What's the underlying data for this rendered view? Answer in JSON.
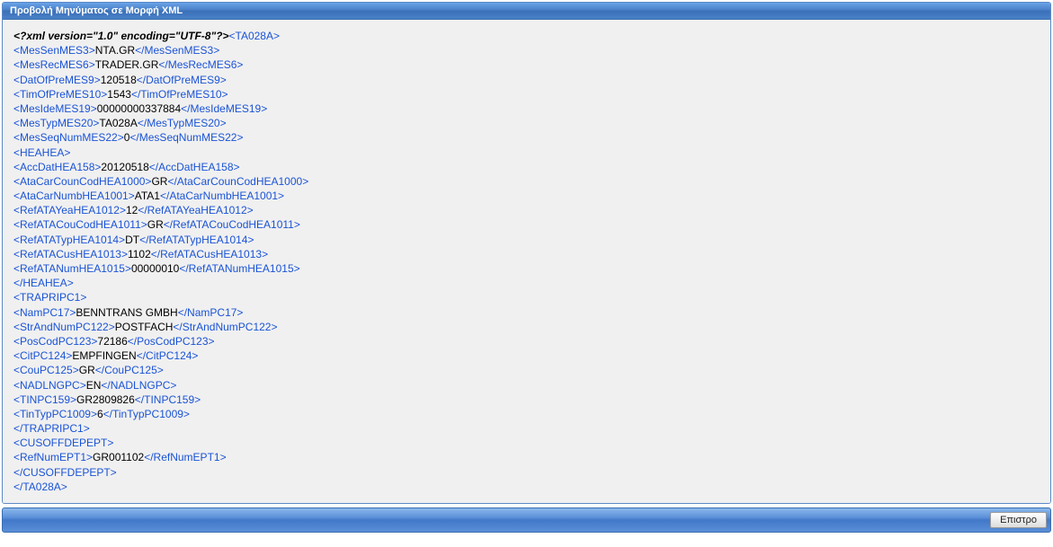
{
  "header": {
    "title": "Προβολή Μηνύματος σε Μορφή XML"
  },
  "footer": {
    "back_label": "Επιστρο"
  },
  "xml": {
    "declaration": "<?xml version=\"1.0\" encoding=\"UTF-8\"?>",
    "root": "TA028A",
    "lines": [
      {
        "type": "simple",
        "tag": "MesSenMES3",
        "value": "NTA.GR"
      },
      {
        "type": "simple",
        "tag": "MesRecMES6",
        "value": "TRADER.GR"
      },
      {
        "type": "simple",
        "tag": "DatOfPreMES9",
        "value": "120518"
      },
      {
        "type": "simple",
        "tag": "TimOfPreMES10",
        "value": "1543"
      },
      {
        "type": "simple",
        "tag": "MesIdeMES19",
        "value": "00000000337884"
      },
      {
        "type": "simple",
        "tag": "MesTypMES20",
        "value": "TA028A"
      },
      {
        "type": "simple",
        "tag": "MesSeqNumMES22",
        "value": "0"
      },
      {
        "type": "open",
        "tag": "HEAHEA"
      },
      {
        "type": "simple",
        "tag": "AccDatHEA158",
        "value": "20120518"
      },
      {
        "type": "simple",
        "tag": "AtaCarCounCodHEA1000",
        "value": "GR"
      },
      {
        "type": "simple",
        "tag": "AtaCarNumbHEA1001",
        "value": "ATA1"
      },
      {
        "type": "simple",
        "tag": "RefATAYeaHEA1012",
        "value": "12"
      },
      {
        "type": "simple",
        "tag": "RefATACouCodHEA1011",
        "value": "GR"
      },
      {
        "type": "simple",
        "tag": "RefATATypHEA1014",
        "value": "DT"
      },
      {
        "type": "simple",
        "tag": "RefATACusHEA1013",
        "value": "1102"
      },
      {
        "type": "simple",
        "tag": "RefATANumHEA1015",
        "value": "00000010"
      },
      {
        "type": "close",
        "tag": "HEAHEA"
      },
      {
        "type": "open",
        "tag": "TRAPRIPC1"
      },
      {
        "type": "simple",
        "tag": "NamPC17",
        "value": "BENNTRANS GMBH"
      },
      {
        "type": "simple",
        "tag": "StrAndNumPC122",
        "value": "POSTFACH"
      },
      {
        "type": "simple",
        "tag": "PosCodPC123",
        "value": "72186"
      },
      {
        "type": "simple",
        "tag": "CitPC124",
        "value": "EMPFINGEN"
      },
      {
        "type": "simple",
        "tag": "CouPC125",
        "value": "GR"
      },
      {
        "type": "simple",
        "tag": "NADLNGPC",
        "value": "EN"
      },
      {
        "type": "simple",
        "tag": "TINPC159",
        "value": "GR2809826"
      },
      {
        "type": "simple",
        "tag": "TinTypPC1009",
        "value": "6"
      },
      {
        "type": "close",
        "tag": "TRAPRIPC1"
      },
      {
        "type": "open",
        "tag": "CUSOFFDEPEPT"
      },
      {
        "type": "simple",
        "tag": "RefNumEPT1",
        "value": "GR001102"
      },
      {
        "type": "close",
        "tag": "CUSOFFDEPEPT"
      }
    ]
  }
}
